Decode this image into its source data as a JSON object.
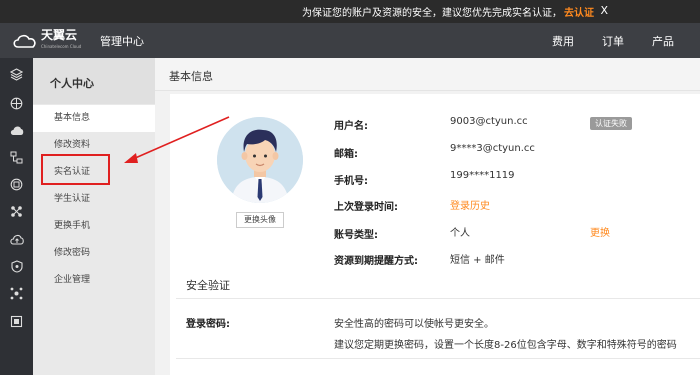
{
  "notice": {
    "message": "为保证您的账户及资源的安全，建议您优先完成实名认证，",
    "link": "去认证",
    "close": "X"
  },
  "header": {
    "brand": "天翼云",
    "brand_sub": "Chinatelecom Cloud",
    "section": "管理中心",
    "nav": [
      "费用",
      "订单",
      "产品"
    ]
  },
  "rail_icons": [
    "layers-icon",
    "globe-icon",
    "cloud-icon",
    "network-icon",
    "monitor-icon",
    "nodes-icon",
    "cloud-up-icon",
    "shield-icon",
    "cluster-icon",
    "storage-icon"
  ],
  "side": {
    "title": "个人中心",
    "items": [
      "基本信息",
      "修改资料",
      "实名认证",
      "学生认证",
      "更换手机",
      "修改密码",
      "企业管理"
    ]
  },
  "main": {
    "title": "基本信息",
    "change_avatar": "更换头像",
    "fields": {
      "username_label": "用户名:",
      "username": "9003@ctyun.cc",
      "auth_badge": "认证失败",
      "email_label": "邮箱:",
      "email": "9****3@ctyun.cc",
      "phone_label": "手机号:",
      "phone": "199****1119",
      "last_login_label": "上次登录时间:",
      "login_history": "登录历史",
      "account_type_label": "账号类型:",
      "account_type": "个人",
      "change": "更换",
      "reminder_label": "资源到期提醒方式:",
      "reminder": "短信 + 邮件"
    },
    "security": {
      "title": "安全验证",
      "pwd_label": "登录密码:",
      "pwd_line1": "安全性高的密码可以使帐号更安全。",
      "pwd_line2": "建议您定期更换密码，设置一个长度8-26位包含字母、数字和特殊符号的密码"
    }
  },
  "colors": {
    "accent": "#ff8a1f",
    "annotation": "#e02020",
    "header_bg": "#3d3f44"
  }
}
